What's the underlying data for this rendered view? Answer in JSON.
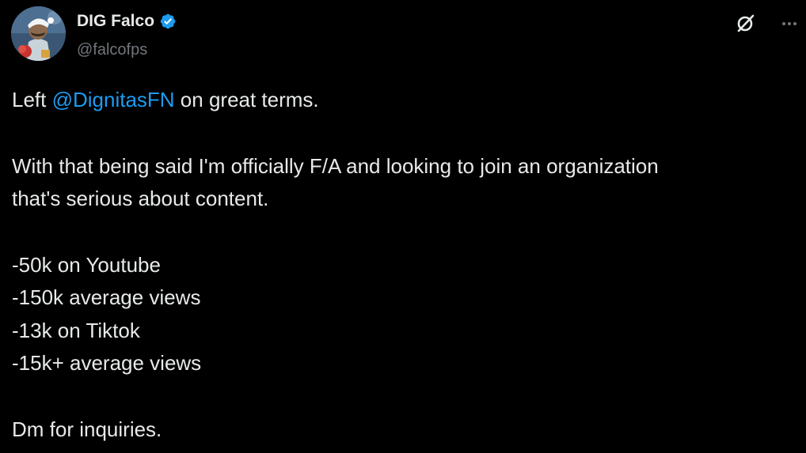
{
  "author": {
    "display_name": "DIG Falco",
    "handle": "@falcofps",
    "verified": true,
    "verified_color": "#1d9bf0"
  },
  "header_actions": {
    "grok_icon": "grok-icon",
    "more_icon": "more-horizontal-icon"
  },
  "tweet": {
    "line1_prefix": "Left ",
    "mention": "@DignitasFN",
    "line1_suffix": " on great terms.",
    "paragraph2_line1": "With that being said I'm officially F/A and looking to join an organization",
    "paragraph2_line2": "that's serious about content.",
    "stats": [
      "-50k on Youtube",
      "-150k average views",
      "-13k on Tiktok",
      "-15k+ average views"
    ],
    "closing": "Dm for inquiries."
  },
  "colors": {
    "background": "#000000",
    "text": "#e7e9ea",
    "secondary_text": "#71767b",
    "link": "#1d9bf0"
  }
}
